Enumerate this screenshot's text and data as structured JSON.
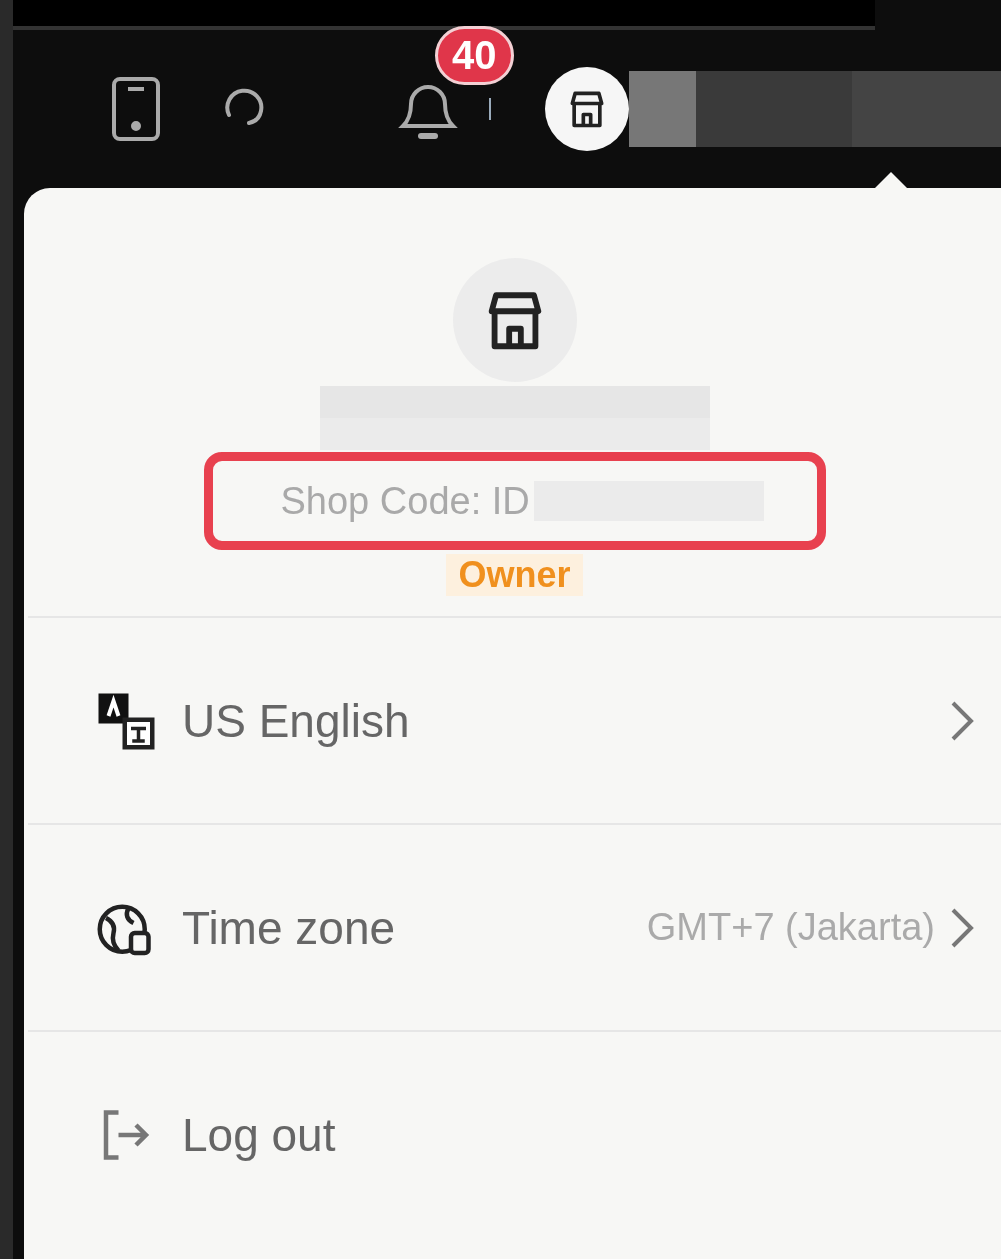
{
  "header": {
    "notification_badge": "40"
  },
  "profile": {
    "shop_code": "Shop Code: ID",
    "role": "Owner",
    "highlighted": true
  },
  "menu": [
    {
      "kind": "language",
      "label": "US English"
    },
    {
      "kind": "timezone",
      "label": "Time zone",
      "value": "GMT+7 (Jakarta)"
    },
    {
      "kind": "logout",
      "label": "Log out"
    }
  ]
}
